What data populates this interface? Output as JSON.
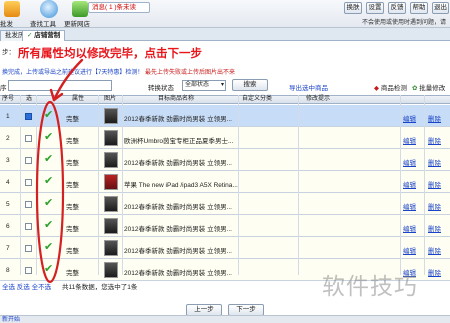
{
  "toolbar": {
    "tool1_label": "批发",
    "tool2_label": "查找工具",
    "tool3_label": "更新网店",
    "messages_label": "消息(   1   )条未读",
    "buttons": [
      "换肤",
      "设置",
      "反馈",
      "帮助",
      "退出"
    ],
    "notice": "不会使用或使用时遇到问题，请"
  },
  "tabs": [
    "批发历",
    "店铺营制"
  ],
  "step_label": "步：",
  "headline": "所有属性均以修改完毕，点击下一步",
  "linkrow": {
    "text": "换完成，上传或导出之前建议进行【7天特惠】检测！",
    "red": "最先上传失败或上传后图片出不来"
  },
  "filter": {
    "label1": "序",
    "status_label": "转换状态",
    "status_value": "全部状态",
    "search": "搜索",
    "export_link": "导出选中商品",
    "check_label": "商品检测",
    "batch_label": "批量修改"
  },
  "table": {
    "headers": [
      "序号",
      "选",
      "属性",
      "图片",
      "目标商品名称",
      "自定义分类",
      "修改提示"
    ],
    "rows": [
      {
        "num": "1",
        "status": "完整",
        "name": "2012春季新款 劲霸时尚男装 立领男...",
        "edit": "编辑",
        "delete": "删除",
        "selected": true
      },
      {
        "num": "2",
        "status": "完整",
        "name": "欧洲杯Umbro茵宝专柜正品夏季男士...",
        "edit": "编辑",
        "delete": "删除",
        "selected": false
      },
      {
        "num": "3",
        "status": "完整",
        "name": "2012春季新款 劲霸时尚男装 立领男...",
        "edit": "编辑",
        "delete": "删除",
        "selected": false
      },
      {
        "num": "4",
        "status": "完整",
        "name": "苹果 The new iPad /ipad3 A5X Retina...",
        "edit": "编辑",
        "delete": "删除",
        "selected": false
      },
      {
        "num": "5",
        "status": "完整",
        "name": "2012春季新款 劲霸时尚男装 立领男...",
        "edit": "编辑",
        "delete": "删除",
        "selected": false
      },
      {
        "num": "6",
        "status": "完整",
        "name": "2012春季新款 劲霸时尚男装 立领男...",
        "edit": "编辑",
        "delete": "删除",
        "selected": false
      },
      {
        "num": "7",
        "status": "完整",
        "name": "2012春季新款 劲霸时尚男装 立领男...",
        "edit": "编辑",
        "delete": "删除",
        "selected": false
      },
      {
        "num": "8",
        "status": "完整",
        "name": "2012春季新款 劲霸时尚男装 立领男...",
        "edit": "编辑",
        "delete": "删除",
        "selected": false
      }
    ]
  },
  "footer": {
    "links": "全选  反选  全不选",
    "info": "共11条数据，您选中了1条",
    "prev": "上一步",
    "next": "下一步",
    "status": "新开始"
  },
  "watermark": "软件技巧",
  "colors": {
    "headline": "#e8151b",
    "link": "#1a44c8",
    "check": "#2aa22a",
    "annotation": "#d42020"
  }
}
